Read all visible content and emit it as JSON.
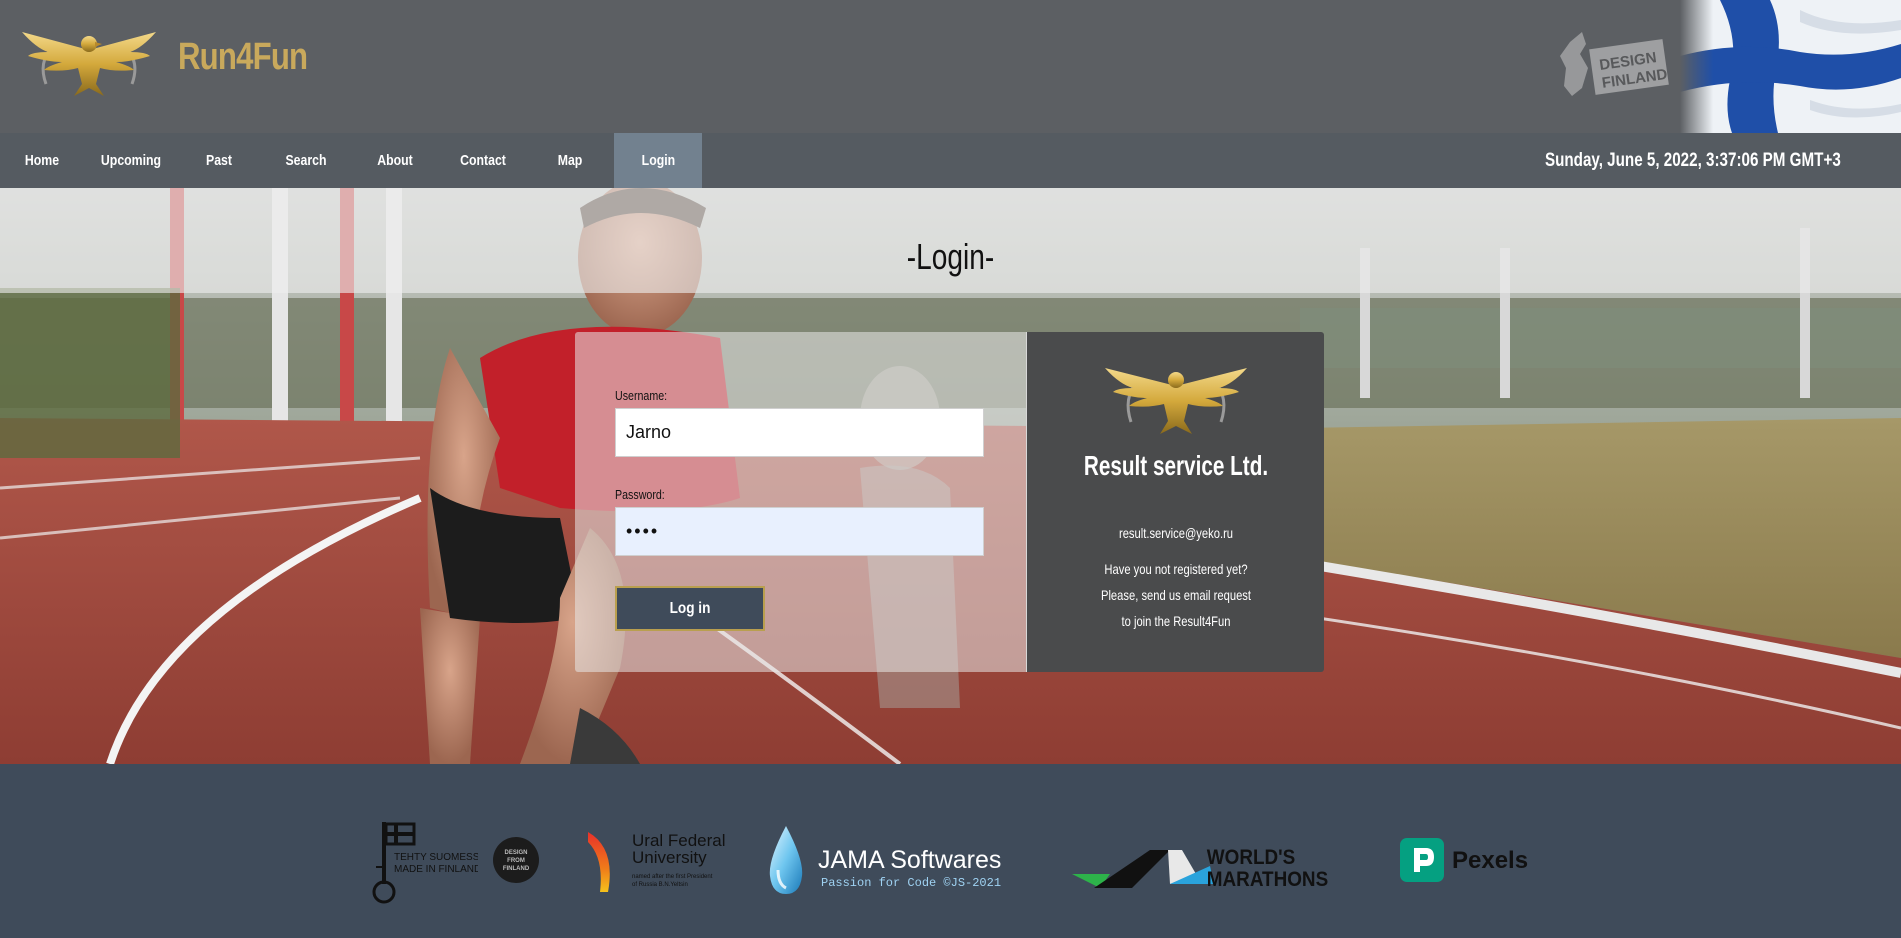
{
  "header": {
    "brand": "Run4Fun",
    "badge_text": [
      "DESIGN",
      "FINLAND"
    ]
  },
  "nav": {
    "items": [
      {
        "label": "Home",
        "active": false
      },
      {
        "label": "Upcoming",
        "active": false
      },
      {
        "label": "Past",
        "active": false
      },
      {
        "label": "Search",
        "active": false
      },
      {
        "label": "About",
        "active": false
      },
      {
        "label": "Contact",
        "active": false
      },
      {
        "label": "Map",
        "active": false
      },
      {
        "label": "Login",
        "active": true
      }
    ],
    "clock": "Sunday, June 5, 2022, 3:37:06 PM GMT+3"
  },
  "page": {
    "title": "-Login-"
  },
  "login_form": {
    "username_label": "Username:",
    "username_value": "Jarno",
    "password_label": "Password:",
    "password_value": "••••",
    "submit_label": "Log in"
  },
  "info": {
    "company": "Result service Ltd.",
    "email": "result.service@yeko.ru",
    "lines": [
      "Have you not registered yet?",
      "Please, send us email request",
      "to join the Result4Fun"
    ]
  },
  "footer": {
    "partners": {
      "made_in_finland": [
        "TEHTY SUOMESSA",
        "MADE IN FINLAND"
      ],
      "design_from_finland": [
        "DESIGN",
        "FROM",
        "FINLAND"
      ],
      "ural": {
        "name": [
          "Ural Federal",
          "University"
        ],
        "sub": [
          "named after the first President",
          "of Russia B.N.Yeltsin"
        ]
      },
      "jama": {
        "name": "JAMA Softwares",
        "tagline": "Passion for Code ©JS-2021"
      },
      "marathons": [
        "WORLD'S",
        "MARATHONS"
      ],
      "pexels": "Pexels"
    }
  },
  "colors": {
    "gold": "#c9a95c",
    "header_bg": "#5c5f63",
    "footer_bg": "#3f4b5a",
    "button_bg": "#3f4b5a",
    "info_bg": "#4a4b4c"
  }
}
